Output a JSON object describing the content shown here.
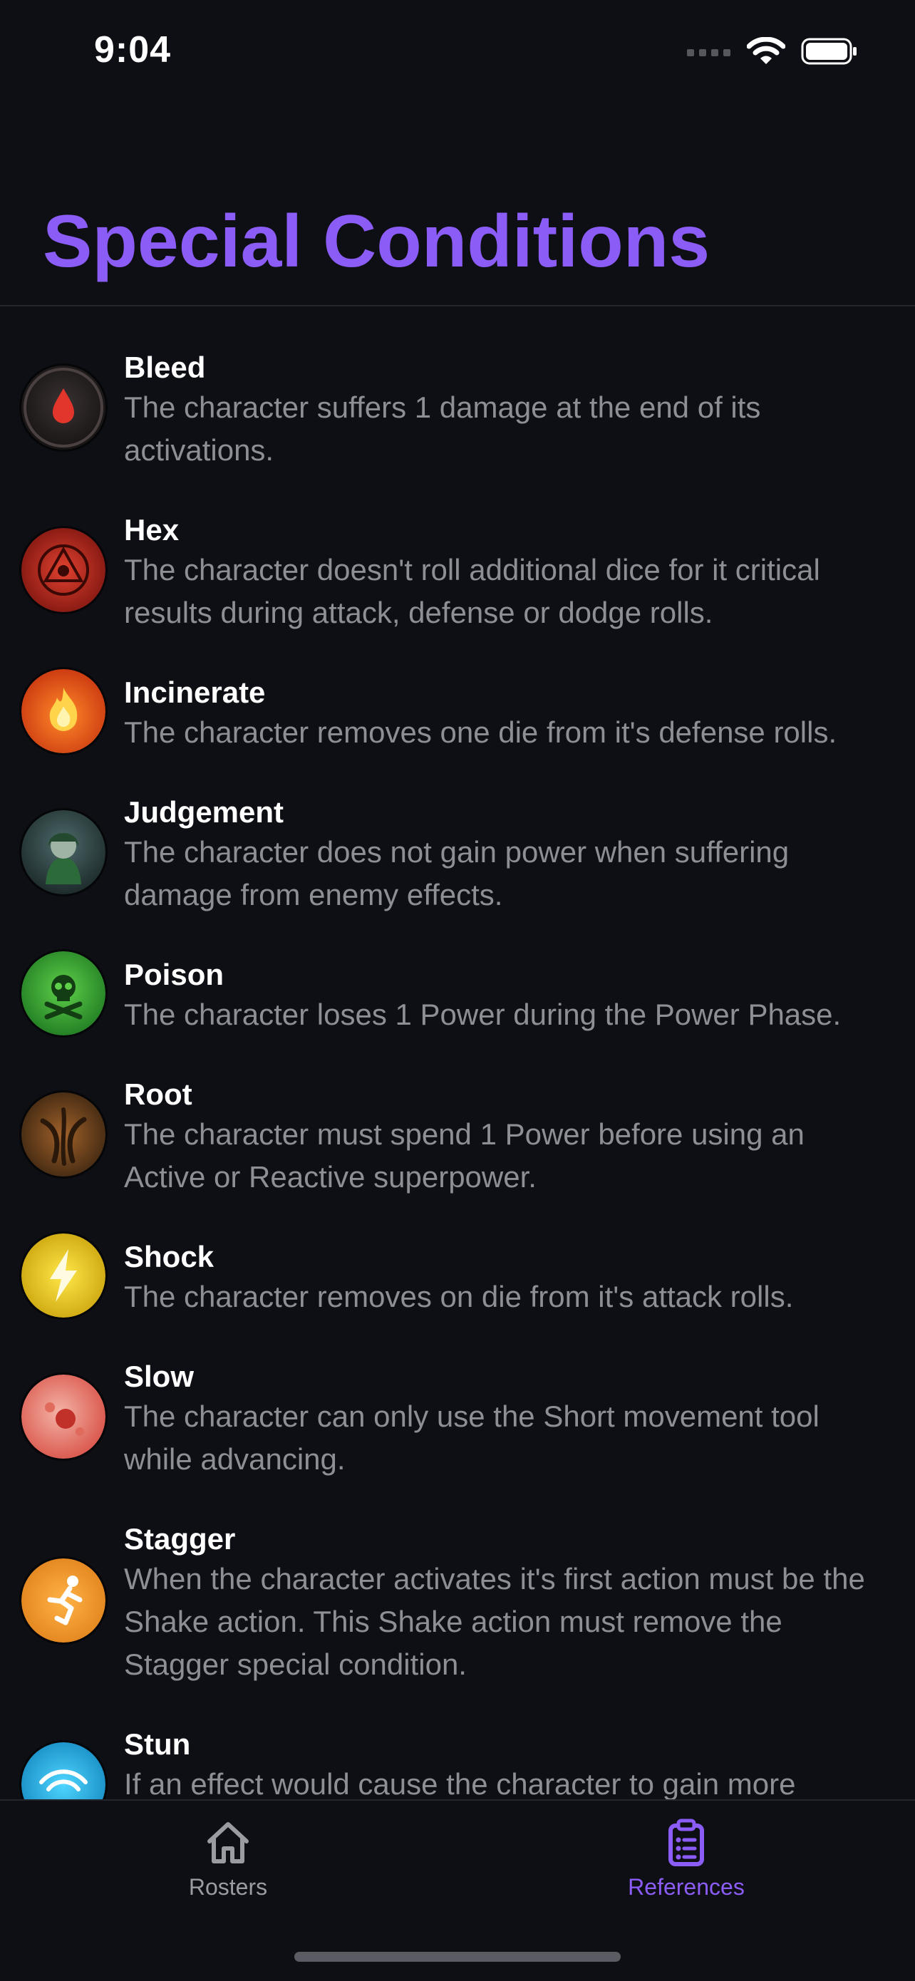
{
  "status_bar": {
    "time": "9:04"
  },
  "page": {
    "title": "Special Conditions"
  },
  "conditions": [
    {
      "name": "Bleed",
      "description": "The character suffers 1 damage at the end of its activations.",
      "icon": "bleed-icon"
    },
    {
      "name": "Hex",
      "description": "The character doesn't roll additional dice for it critical results during attack, defense or dodge rolls.",
      "icon": "hex-icon"
    },
    {
      "name": "Incinerate",
      "description": "The character removes one die from it's defense rolls.",
      "icon": "incinerate-icon"
    },
    {
      "name": "Judgement",
      "description": "The character does not gain power when suffering damage from enemy effects.",
      "icon": "judgement-icon"
    },
    {
      "name": "Poison",
      "description": "The character loses 1 Power during the Power Phase.",
      "icon": "poison-icon"
    },
    {
      "name": "Root",
      "description": "The character must spend 1 Power before using an Active or Reactive superpower.",
      "icon": "root-icon"
    },
    {
      "name": "Shock",
      "description": "The character removes on die from it's attack rolls.",
      "icon": "shock-icon"
    },
    {
      "name": "Slow",
      "description": "The character can only use the Short movement tool while advancing.",
      "icon": "slow-icon"
    },
    {
      "name": "Stagger",
      "description": "When the character activates it's first action must be the Shake action. This Shake action must remove the Stagger special condition.",
      "icon": "stagger-icon"
    },
    {
      "name": "Stun",
      "description": "If an effect would cause the character to gain more",
      "icon": "stun-icon"
    }
  ],
  "tab_bar": {
    "tabs": [
      {
        "label": "Rosters",
        "icon": "home-icon",
        "selected": false
      },
      {
        "label": "References",
        "icon": "clipboard-list-icon",
        "selected": true
      }
    ]
  },
  "colors": {
    "accent": "#8b5cf6",
    "background": "#0e0f15",
    "secondary_text": "#8d8e96"
  }
}
